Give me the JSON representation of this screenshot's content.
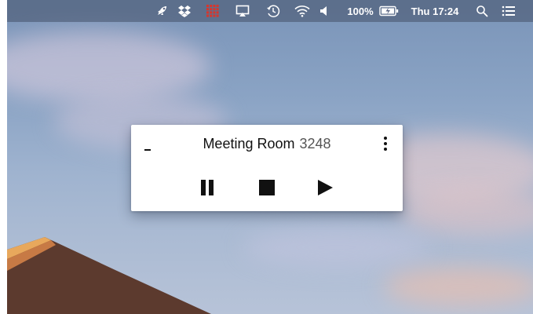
{
  "menubar": {
    "battery_percent": "100%",
    "clock": "Thu 17:24",
    "status_icons": [
      "rocket-icon",
      "dropbox-icon",
      "grid-app-icon",
      "airplay-icon",
      "time-machine-icon",
      "wifi-icon",
      "volume-icon",
      "battery-charging-icon",
      "spotlight-search-icon",
      "notification-center-icon"
    ],
    "grid_icon_color": "#d9352b"
  },
  "player": {
    "room_name": "Meeting Room",
    "room_code": "3248",
    "controls": [
      "pause-icon",
      "stop-icon",
      "play-icon"
    ]
  },
  "desktop": {
    "wallpaper": "sky-with-desert-dune"
  }
}
